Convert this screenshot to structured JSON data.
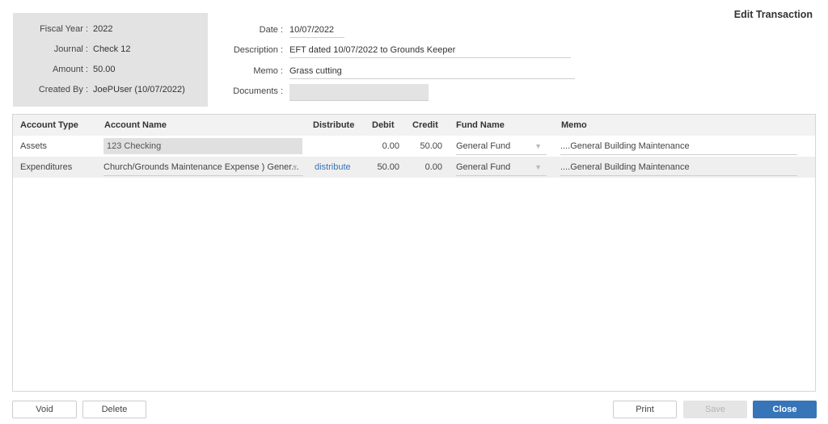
{
  "title": "Edit Transaction",
  "summary": {
    "fiscal_year_label": "Fiscal Year :",
    "fiscal_year": "2022",
    "journal_label": "Journal :",
    "journal": "Check 12",
    "amount_label": "Amount :",
    "amount": "50.00",
    "created_by_label": "Created By :",
    "created_by": "JoePUser (10/07/2022)"
  },
  "fields": {
    "date_label": "Date :",
    "date": "10/07/2022",
    "description_label": "Description :",
    "description": "EFT dated 10/07/2022 to Grounds Keeper",
    "memo_label": "Memo :",
    "memo": "Grass cutting",
    "documents_label": "Documents :",
    "documents": ""
  },
  "grid": {
    "headers": {
      "account_type": "Account Type",
      "account_name": "Account Name",
      "distribute": "Distribute",
      "debit": "Debit",
      "credit": "Credit",
      "fund_name": "Fund Name",
      "memo": "Memo"
    },
    "rows": [
      {
        "account_type": "Assets",
        "account_name": "123 Checking",
        "distribute": "",
        "debit": "0.00",
        "credit": "50.00",
        "fund_name": "General Fund",
        "memo": "....General Building Maintenance"
      },
      {
        "account_type": "Expenditures",
        "account_name": "Church/Grounds Maintenance Expense ) Gener...",
        "distribute": "distribute",
        "debit": "50.00",
        "credit": "0.00",
        "fund_name": "General Fund",
        "memo": "....General Building Maintenance"
      }
    ]
  },
  "buttons": {
    "void": "Void",
    "delete": "Delete",
    "print": "Print",
    "save": "Save",
    "close": "Close"
  },
  "icons": {
    "dropdown": "▼"
  },
  "colors": {
    "primary": "#3875b8",
    "link": "#3a72b6",
    "summary_bg": "#e3e3e3"
  }
}
